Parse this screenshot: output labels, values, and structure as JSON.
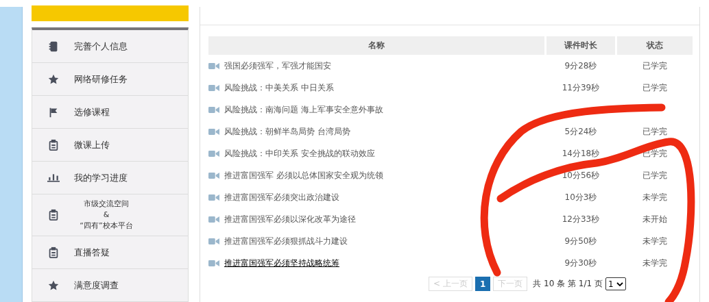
{
  "sidebar": {
    "items": [
      {
        "kind": "notebook",
        "lines": [
          "完善个人信息"
        ]
      },
      {
        "kind": "star",
        "lines": [
          "网络研修任务"
        ]
      },
      {
        "kind": "flag",
        "lines": [
          "选修课程"
        ]
      },
      {
        "kind": "clipboard",
        "lines": [
          "微课上传"
        ]
      },
      {
        "kind": "chart",
        "lines": [
          "我的学习进度"
        ]
      },
      {
        "kind": "clipboard",
        "lines": [
          "市级交流空间",
          "&",
          "“四有”校本平台"
        ]
      },
      {
        "kind": "clipboard",
        "lines": [
          "直播答疑"
        ]
      },
      {
        "kind": "star",
        "lines": [
          "满意度调查"
        ]
      }
    ]
  },
  "table": {
    "columns": [
      "名称",
      "课件时长",
      "状态"
    ],
    "rows": [
      {
        "name": "强国必须强军，军强才能国安",
        "duration": "9分28秒",
        "status": "已学完",
        "hovered": false
      },
      {
        "name": "风险挑战：中美关系 中日关系",
        "duration": "11分39秒",
        "status": "已学完",
        "hovered": false
      },
      {
        "name": "风险挑战：南海问题 海上军事安全意外事故",
        "hovered": false
      },
      {
        "name": "风险挑战：朝鲜半岛局势 台湾局势",
        "duration": "5分24秒",
        "status": "已学完",
        "hovered": false
      },
      {
        "name": "风险挑战：中印关系 安全挑战的联动效应",
        "duration": "14分18秒",
        "status": "已学完",
        "hovered": false
      },
      {
        "name": "推进富国强军 必须以总体国家安全观为统领",
        "duration": "10分56秒",
        "status": "已学完",
        "hovered": false
      },
      {
        "name": "推进富国强军必须突出政治建设",
        "duration": "10分3秒",
        "status": "未学完",
        "hovered": false
      },
      {
        "name": "推进富国强军必须以深化改革为途径",
        "duration": "12分33秒",
        "status": "未开始",
        "hovered": false
      },
      {
        "name": "推进富国强军必须狠抓战斗力建设",
        "duration": "9分50秒",
        "status": "未学完",
        "hovered": false
      },
      {
        "name": "推进富国强军必须坚持战略统筹",
        "duration": "9分30秒",
        "status": "未学完",
        "hovered": true
      }
    ]
  },
  "pagination": {
    "prev": {
      "label": "< 上一页",
      "disabled": true
    },
    "pages": [
      {
        "label": "1",
        "selected": true
      }
    ],
    "next": {
      "label": "下一页",
      "disabled": true
    },
    "summary": "共 10 条 第 1/1 页",
    "select": "1"
  }
}
